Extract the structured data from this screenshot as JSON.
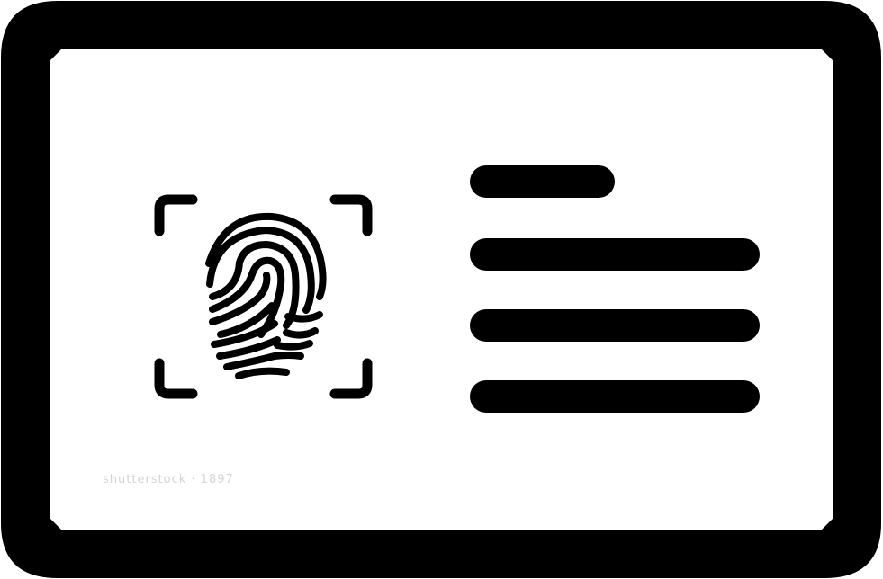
{
  "icon": {
    "name": "id-card-fingerprint-icon",
    "color": "#000000",
    "background": "#ffffff",
    "text_lines": 4
  },
  "watermark": {
    "text": "shutterstock · 1897"
  }
}
